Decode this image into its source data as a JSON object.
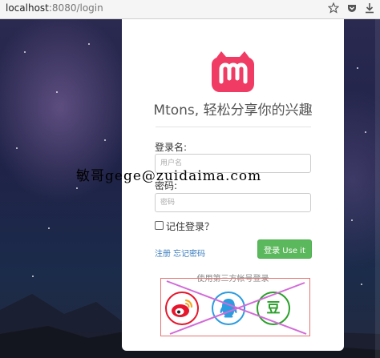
{
  "browser": {
    "url_host": "localhost",
    "url_rest": ":8080/login",
    "icons": [
      "star-icon",
      "pocket-icon",
      "download-icon"
    ]
  },
  "login": {
    "logo_icon": "mtons-logo-icon",
    "app_title": "Mtons, 轻松分享你的兴趣",
    "username_label": "登录名:",
    "username_placeholder": "用户名",
    "password_label": "密码:",
    "password_placeholder": "密码",
    "remember_label": "记住登录？",
    "register_link": "注册",
    "forgot_link": "忘记密码",
    "login_button": "登录 Use it",
    "third_party_label": "使用第三方帐号登录",
    "social": {
      "weibo_icon": "weibo-icon",
      "qq_icon": "qq-icon",
      "douban_text": "豆"
    }
  },
  "watermark": "敏哥gege@zuidaima.com",
  "colors": {
    "primary_button": "#5cb85c",
    "link": "#3c7ebf",
    "logo": "#f03c64",
    "annotation": "#e57373",
    "cross_out": "#d26bd8"
  }
}
